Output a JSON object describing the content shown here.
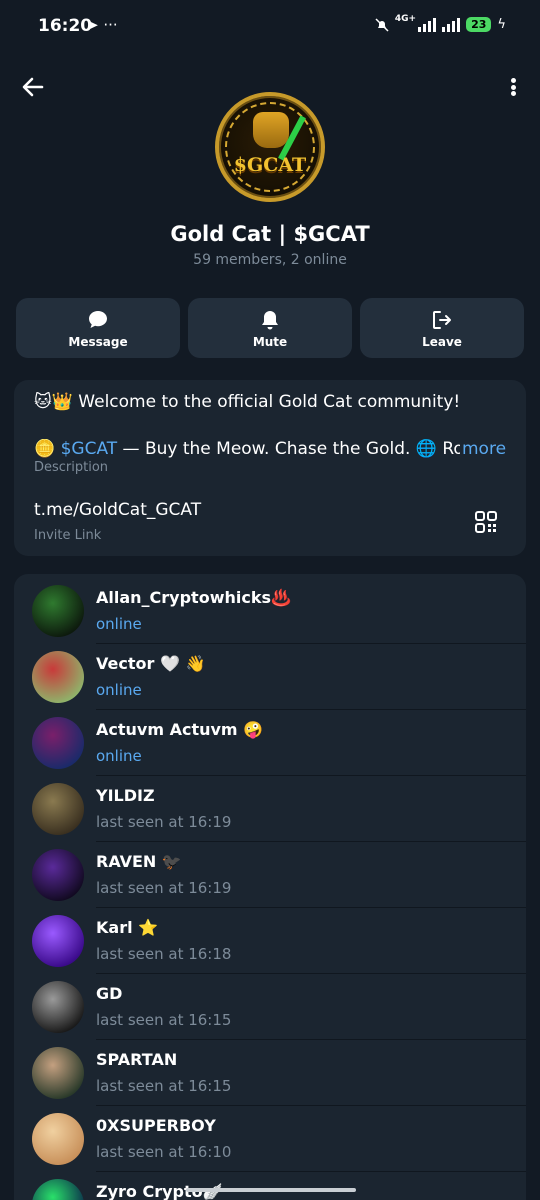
{
  "status_bar": {
    "time": "16:20",
    "left_icons": "➤ ···",
    "network": "4G+",
    "battery": "23"
  },
  "header": {
    "title": "Gold Cat | $GCAT",
    "subtitle": "59 members, 2 online",
    "avatar_text": "$GCAT"
  },
  "actions": [
    {
      "label": "Message",
      "icon": "message-icon"
    },
    {
      "label": "Mute",
      "icon": "bell-icon"
    },
    {
      "label": "Leave",
      "icon": "leave-icon"
    }
  ],
  "info": {
    "description_line1": "🐱👑 Welcome to the official Gold Cat community!",
    "description_line2_prefix": "🪙 ",
    "description_line2_highlight": "$GCAT",
    "description_line2_rest": " — Buy the Meow. Chase the Gold. 🌐 Roa",
    "more": "more",
    "description_label": "Description",
    "invite_link": "t.me/GoldCat_GCAT",
    "invite_label": "Invite Link"
  },
  "members": [
    {
      "name": "Allan_Cryptowhicks♨️",
      "status": "online",
      "online": true,
      "avatar_colors": [
        "#0d1a0d",
        "#2f7a2f"
      ]
    },
    {
      "name": "Vector 🤍 👋",
      "status": "online",
      "online": true,
      "avatar_colors": [
        "#8fb36a",
        "#c83a3a"
      ]
    },
    {
      "name": "Actuvm Actuvm 🤪",
      "status": "online",
      "online": true,
      "avatar_colors": [
        "#1a2a6a",
        "#7a1f6a"
      ]
    },
    {
      "name": "YILDIZ",
      "status": "last seen at 16:19",
      "online": false,
      "avatar_colors": [
        "#3a3020",
        "#8a7a50"
      ]
    },
    {
      "name": "RAVEN 🐦‍⬛",
      "status": "last seen at 16:19",
      "online": false,
      "avatar_colors": [
        "#120a22",
        "#5a2a9a"
      ]
    },
    {
      "name": "Karl ⭐",
      "status": "last seen at 16:18",
      "online": false,
      "avatar_colors": [
        "#3a0a8a",
        "#9a5aff"
      ]
    },
    {
      "name": "GD",
      "status": "last seen at 16:15",
      "online": false,
      "avatar_colors": [
        "#1a1a1a",
        "#9a9a9a"
      ]
    },
    {
      "name": "SPARTAN",
      "status": "last seen at 16:15",
      "online": false,
      "avatar_colors": [
        "#2a3a2a",
        "#c4a080"
      ]
    },
    {
      "name": "0XSUPERBOY",
      "status": "last seen at 16:10",
      "online": false,
      "avatar_colors": [
        "#c8905a",
        "#f0d0a0"
      ]
    },
    {
      "name": "Zyro Crypto🪽",
      "status": "",
      "online": false,
      "avatar_colors": [
        "#0a2a4a",
        "#2ae06a"
      ]
    }
  ]
}
